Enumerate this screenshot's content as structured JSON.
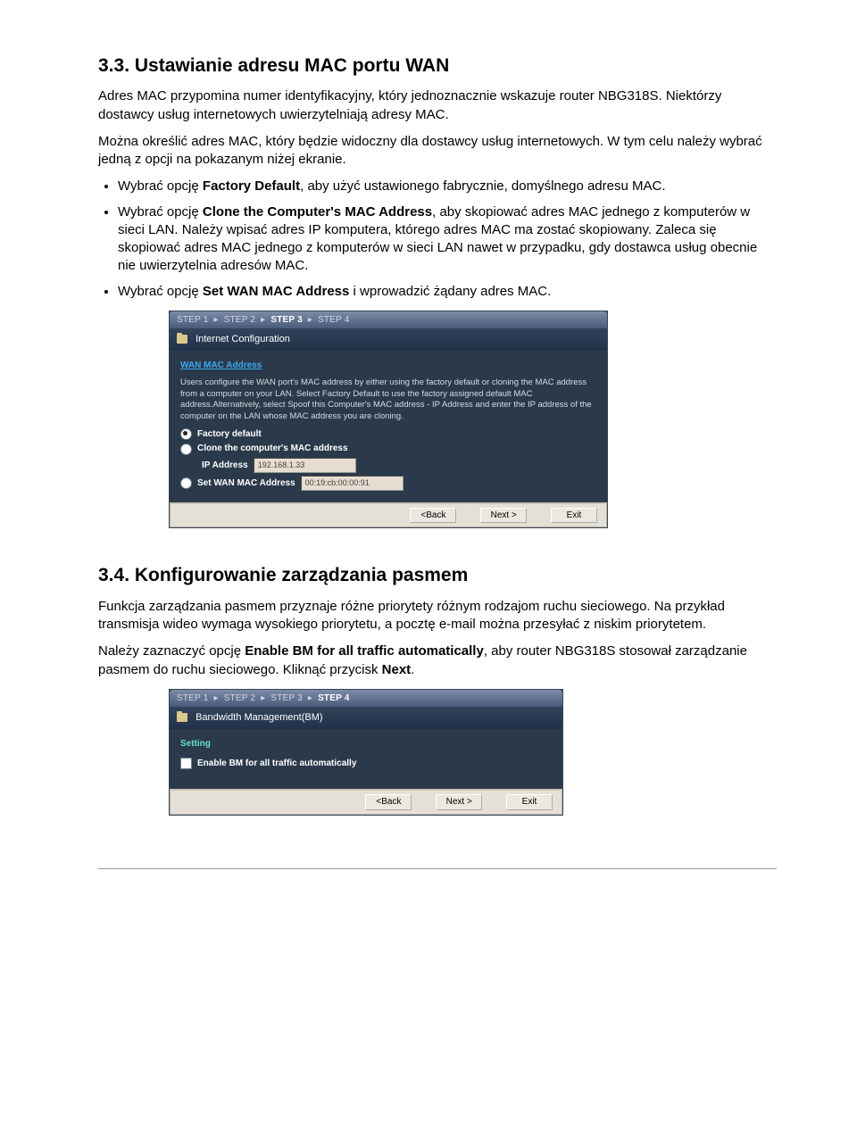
{
  "section33": {
    "heading": "3.3. Ustawianie adresu MAC portu WAN",
    "p1": "Adres MAC przypomina numer identyfikacyjny, który jednoznacznie wskazuje router NBG318S. Niektórzy dostawcy usług internetowych uwierzytelniają adresy MAC.",
    "p2": "Można określić adres MAC, który będzie widoczny dla dostawcy usług internetowych. W tym celu należy wybrać jedną z opcji na pokazanym niżej ekranie.",
    "b1a": "Wybrać opcję ",
    "b1b": "Factory Default",
    "b1c": ", aby użyć ustawionego fabrycznie, domyślnego adresu MAC.",
    "b2a": "Wybrać opcję ",
    "b2b": "Clone the Computer's MAC Address",
    "b2c": ", aby skopiować adres MAC jednego z komputerów w sieci LAN. Należy wpisać adres IP komputera, którego adres MAC ma zostać skopiowany. Zaleca się skopiować adres MAC jednego z komputerów w sieci LAN nawet w przypadku, gdy dostawca usług obecnie nie uwierzytelnia adresów MAC.",
    "b3a": "Wybrać opcję ",
    "b3b": "Set WAN MAC Address",
    "b3c": " i wprowadzić żądany adres MAC."
  },
  "panel1": {
    "steps": {
      "s1": "STEP 1",
      "s2": "STEP 2",
      "s3": "STEP 3",
      "s4": "STEP 4",
      "arrow": "▸"
    },
    "title": "Internet Configuration",
    "section": "WAN MAC Address",
    "desc": "Users configure the WAN port's MAC address by either using the factory default or cloning the MAC address from a computer on your LAN. Select Factory Default to use the factory assigned default MAC address.Alternatively, select Spoof this Computer's MAC address - IP Address and enter the IP address of the computer on the LAN whose MAC address you are cloning.",
    "opt1": "Factory default",
    "opt2": "Clone the computer's MAC address",
    "iplabel": "IP Address",
    "ipval": "192.168.1.33",
    "opt3": "Set WAN MAC Address",
    "macval": "00:19:cb:00:00:91",
    "btnBack": "<Back",
    "btnNext": "Next >",
    "btnExit": "Exit"
  },
  "section34": {
    "heading": "3.4. Konfigurowanie zarządzania pasmem",
    "p1": "Funkcja zarządzania pasmem przyznaje różne priorytety różnym rodzajom ruchu sieciowego. Na przykład transmisja wideo wymaga wysokiego priorytetu, a pocztę e-mail można przesyłać z niskim priorytetem.",
    "p2a": "Należy zaznaczyć opcję ",
    "p2b": "Enable BM for all traffic automatically",
    "p2c": ", aby router NBG318S stosował zarządzanie pasmem do ruchu sieciowego. Kliknąć przycisk ",
    "p2d": "Next",
    "p2e": "."
  },
  "panel2": {
    "steps": {
      "s1": "STEP 1",
      "s2": "STEP 2",
      "s3": "STEP 3",
      "s4": "STEP 4",
      "arrow": "▸"
    },
    "title": "Bandwidth Management(BM)",
    "section": "Setting",
    "opt1": "Enable BM for all traffic automatically",
    "btnBack": "<Back",
    "btnNext": "Next >",
    "btnExit": "Exit"
  }
}
